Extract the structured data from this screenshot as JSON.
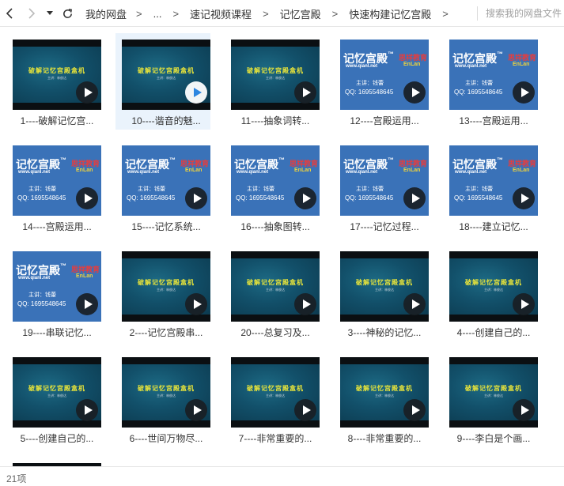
{
  "breadcrumb": {
    "items": [
      "我的网盘",
      "...",
      "速记视频课程",
      "记忆宫殿",
      "快速构建记忆宫殿"
    ],
    "separator": ">"
  },
  "search": {
    "placeholder": "搜索我的网盘文件"
  },
  "thumb_text": {
    "dark_title": "破解记忆宫殿盒机",
    "dark_subtitle": "主讲：林俊达",
    "brand_title": "记忆宫殿",
    "brand_tm": "™",
    "brand_url": "www.qianl.net",
    "brand_org": "思祥教育",
    "brand_org_en": "EnLan",
    "brand_teacher": "主讲：钱蕾",
    "brand_qq": "QQ: 1695548645"
  },
  "files": [
    {
      "name": "1----破解记忆宫...",
      "style": "dark",
      "selected": false
    },
    {
      "name": "10----谐音的魅...",
      "style": "dark",
      "selected": true
    },
    {
      "name": "11----抽象词转...",
      "style": "dark",
      "selected": false
    },
    {
      "name": "12----宫殿运用...",
      "style": "brand",
      "selected": false
    },
    {
      "name": "13----宫殿运用...",
      "style": "brand",
      "selected": false
    },
    {
      "name": "14----宫殿运用...",
      "style": "brand",
      "selected": false
    },
    {
      "name": "15----记忆系统...",
      "style": "brand",
      "selected": false
    },
    {
      "name": "16----抽象图转...",
      "style": "brand",
      "selected": false
    },
    {
      "name": "17----记忆过程...",
      "style": "brand",
      "selected": false
    },
    {
      "name": "18----建立记忆...",
      "style": "brand",
      "selected": false
    },
    {
      "name": "19----串联记忆...",
      "style": "brand",
      "selected": false
    },
    {
      "name": "2----记忆宫殿串...",
      "style": "dark",
      "selected": false
    },
    {
      "name": "20----总复习及...",
      "style": "dark",
      "selected": false
    },
    {
      "name": "3----神秘的记忆...",
      "style": "dark",
      "selected": false
    },
    {
      "name": "4----创建自己的...",
      "style": "dark",
      "selected": false
    },
    {
      "name": "5----创建自己的...",
      "style": "dark",
      "selected": false
    },
    {
      "name": "6----世间万物尽...",
      "style": "dark",
      "selected": false
    },
    {
      "name": "7----非常重要的...",
      "style": "dark",
      "selected": false
    },
    {
      "name": "8----非常重要的...",
      "style": "dark",
      "selected": false
    },
    {
      "name": "9----李白是个画...",
      "style": "dark",
      "selected": false
    }
  ],
  "status": {
    "count": "21项"
  }
}
